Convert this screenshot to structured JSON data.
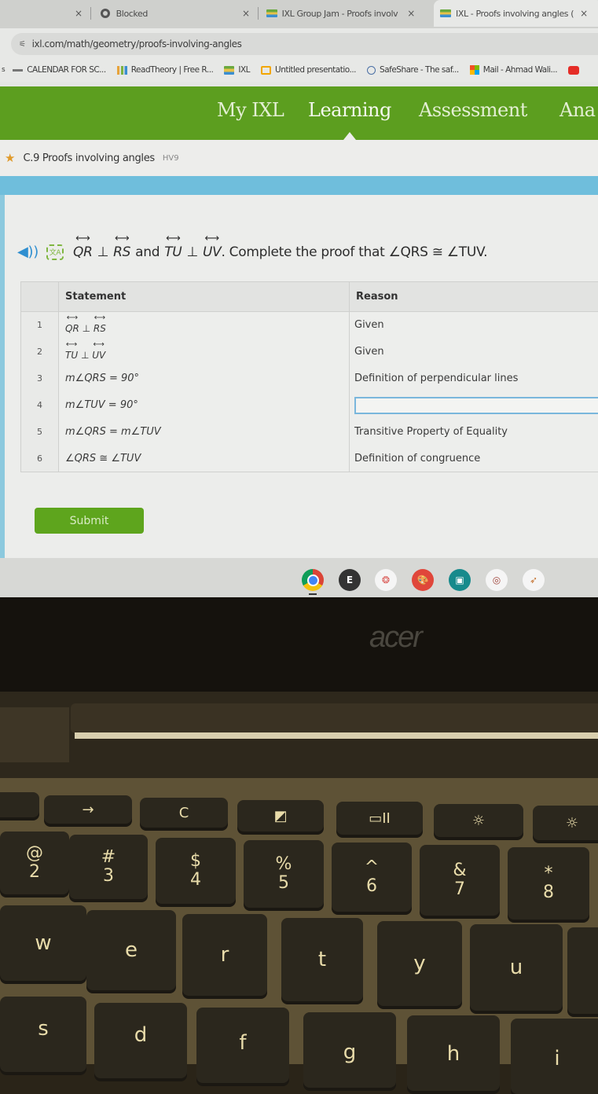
{
  "browser": {
    "tabs": [
      {
        "title": "Blocked",
        "icon": "globe-icon",
        "active": false
      },
      {
        "title": "IXL Group Jam - Proofs involv",
        "icon": "ixl-icon",
        "active": false
      },
      {
        "title": "IXL - Proofs involving angles (",
        "icon": "ixl-icon",
        "active": true
      }
    ],
    "close_glyph": "×",
    "url": "ixl.com/math/geometry/proofs-involving-angles",
    "bookmarks": [
      {
        "label": "CALENDAR FOR SC...",
        "icon": "calendar-icon"
      },
      {
        "label": "ReadTheory | Free R...",
        "icon": "readtheory-icon"
      },
      {
        "label": "IXL",
        "icon": "ixl-icon"
      },
      {
        "label": "Untitled presentatio...",
        "icon": "slides-icon"
      },
      {
        "label": "SafeShare - The saf...",
        "icon": "safeshare-icon"
      },
      {
        "label": "Mail - Ahmad Wali...",
        "icon": "microsoft-icon"
      }
    ]
  },
  "ixl": {
    "nav": [
      "My IXL",
      "Learning",
      "Assessment",
      "Ana"
    ],
    "active_nav": "Learning",
    "brand_color": "#5c9e1f",
    "skill": {
      "title": "C.9 Proofs involving angles",
      "code": "HV9"
    },
    "question": {
      "line1": "QR",
      "perp1": "⊥",
      "line2": "RS",
      "and": "and",
      "line3": "TU",
      "perp2": "⊥",
      "line4": "UV",
      "rest": ". Complete the proof that ∠QRS ≅ ∠TUV."
    },
    "table": {
      "headers": {
        "statement": "Statement",
        "reason": "Reason"
      },
      "rows": [
        {
          "num": "1",
          "statement": {
            "a": "QR",
            "op": " ⊥ ",
            "b": "RS"
          },
          "reason": "Given"
        },
        {
          "num": "2",
          "statement": {
            "a": "TU",
            "op": " ⊥ ",
            "b": "UV"
          },
          "reason": "Given"
        },
        {
          "num": "3",
          "statement": "m∠QRS = 90°",
          "reason": "Definition of perpendicular lines"
        },
        {
          "num": "4",
          "statement": "m∠TUV = 90°",
          "reason": ""
        },
        {
          "num": "5",
          "statement": "m∠QRS = m∠TUV",
          "reason": "Transitive Property of Equality"
        },
        {
          "num": "6",
          "statement": "∠QRS ≅ ∠TUV",
          "reason": "Definition of congruence"
        }
      ]
    },
    "submit_label": "Submit"
  },
  "shelf": {
    "apps": [
      {
        "name": "chrome",
        "label": ""
      },
      {
        "name": "app-e",
        "label": "E"
      },
      {
        "name": "app-dots",
        "label": "❂"
      },
      {
        "name": "app-paint",
        "label": "🎨"
      },
      {
        "name": "app-screen",
        "label": "▣"
      },
      {
        "name": "app-swirl",
        "label": "◎"
      },
      {
        "name": "app-bird",
        "label": "➶"
      }
    ]
  },
  "laptop": {
    "brand": "acer",
    "function_keys": [
      "→",
      "C",
      "◩",
      "▭II",
      "☼",
      "☼"
    ],
    "number_keys": [
      {
        "top": "@",
        "bot": "2"
      },
      {
        "top": "#",
        "bot": "3"
      },
      {
        "top": "$",
        "bot": "4"
      },
      {
        "top": "%",
        "bot": "5"
      },
      {
        "top": "^",
        "bot": "6"
      },
      {
        "top": "&",
        "bot": "7"
      },
      {
        "top": "*",
        "bot": "8"
      }
    ],
    "row_qwerty": [
      "w",
      "e",
      "r",
      "t",
      "y",
      "u"
    ],
    "row_asdf": [
      "s",
      "d",
      "f",
      "g",
      "h",
      "i"
    ]
  }
}
